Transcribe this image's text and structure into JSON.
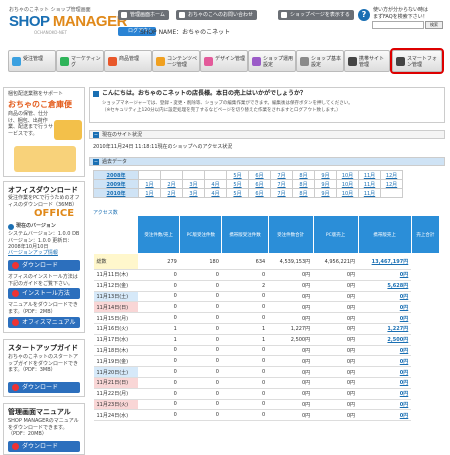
{
  "header": {
    "brand_sub": "おちゃのこネット ショップ管理画面",
    "brand_main_a": "SHOP ",
    "brand_main_b": "MANAGER",
    "brand_tag": "OCHANOKO-NET",
    "btn_home": "管理画面ホーム",
    "btn_contact": "おちゃのこへのお問い合わせ",
    "btn_shop": "ショップページを表示する",
    "logout": "ログアウト",
    "shop_name": "SHOP NAME：おちゃのこネット",
    "help_text": "使い方が分からない時は\nまずFAQを検索下さい！",
    "help_button": "検索"
  },
  "nav": [
    {
      "label": "受注管理",
      "color": "#3aa0e0"
    },
    {
      "label": "マーケティング",
      "color": "#2fb45a"
    },
    {
      "label": "商品管理",
      "color": "#e8572a"
    },
    {
      "label": "コンテンツページ管理",
      "color": "#f0a020"
    },
    {
      "label": "デザイン管理",
      "color": "#e35a9a"
    },
    {
      "label": "ショップ運用設定",
      "color": "#9b5bc8"
    },
    {
      "label": "ショップ基本設定",
      "color": "#8a8a8a"
    },
    {
      "label": "携帯サイト管理",
      "color": "#444"
    },
    {
      "label": "スマートフォン管理",
      "color": "#444"
    }
  ],
  "sidebar": {
    "ad_sub": "梱包配送業務をサポート",
    "ad_title": "おちゃのこ倉庫便",
    "ad_text": "商品の保管、仕分け、梱包、出荷作業、配送まで行うサービスです。",
    "office_head": "オフィスダウンロード",
    "office_text": "受注作業をPCで行うためのオフィスのダウンロード（36MB）",
    "office_logo": "OFFICE",
    "version_head": "現在のバージョン",
    "version_text": "システムバージョン：1.0.0 DBバージョン：1.0.0 更新日：2008年10月10日",
    "version_link": "バージョンアップ情報",
    "btn_download": "ダウンロード",
    "install_text": "オフィスのインストール方法は下記のガイドをご覧下さい。",
    "btn_install": "インストール方法",
    "manual_text": "マニュアルをダウンロードできます。（PDF：2MB）",
    "btn_office_manual": "オフィスマニュアル",
    "startup_head": "スタートアップガイド",
    "startup_text": "おちゃのこネットのスタートアップガイドをダウンロードできます。（PDF：3MB）",
    "btn_download2": "ダウンロード",
    "admin_head": "管理画面マニュアル",
    "admin_text": "SHOP MANAGERのマニュアルをダウンロードできます。（PDF：20MB）",
    "btn_download3": "ダウンロード"
  },
  "main": {
    "greeting": "こんにちは。おちゃのこネットの店長様。本日の売上はいかがでしょうか？",
    "notice1": "ショップマネージャーでは、登録・変更・削除等、ショップの編集作業ができます。編集後は保存ボタンを押してください。",
    "notice2": "（※セキュリティ上120分以内に設定処理を完了するなどページを切り替えた作業をされますとログアウト致します。）",
    "status_title": "現在のサイト状況",
    "status_time": "2010年11月24日 11:18:11現在のショップへのアクセス状況",
    "past_title": "過去データ",
    "years": [
      {
        "year": "2008年",
        "months": [
          "",
          "",
          "",
          "",
          "5月",
          "6月",
          "7月",
          "8月",
          "9月",
          "10月",
          "11月",
          "12月"
        ]
      },
      {
        "year": "2009年",
        "months": [
          "1月",
          "2月",
          "3月",
          "4月",
          "5月",
          "6月",
          "7月",
          "8月",
          "9月",
          "10月",
          "11月",
          "12月"
        ]
      },
      {
        "year": "2010年",
        "months": [
          "1月",
          "2月",
          "3月",
          "4月",
          "5月",
          "6月",
          "7月",
          "8月",
          "9月",
          "10月",
          "11月",
          ""
        ]
      }
    ],
    "access_link": "アクセス数",
    "headers": [
      "受注件数/売上",
      "PC版受注件数",
      "携帯版受注件数",
      "受注件数合計",
      "PC版売上",
      "携帯版売上",
      "売上合計"
    ],
    "total_row": {
      "label": "総数",
      "pc": "279",
      "mobile": "180",
      "total": "634",
      "pc_sales": "4,539,153円",
      "mobile_sales": "4,956,221円",
      "sum": "13,467,197円"
    },
    "rows": [
      {
        "day": "11月11日(木)",
        "type": "",
        "a": "0",
        "b": "0",
        "c": "0",
        "d": "0円",
        "e": "0円",
        "f": "0円"
      },
      {
        "day": "11月12日(金)",
        "type": "",
        "a": "0",
        "b": "0",
        "c": "2",
        "d": "0円",
        "e": "0円",
        "f": "5,628円"
      },
      {
        "day": "11月13日(土)",
        "type": "sat",
        "a": "0",
        "b": "0",
        "c": "0",
        "d": "0円",
        "e": "0円",
        "f": "0円"
      },
      {
        "day": "11月14日(日)",
        "type": "sun",
        "a": "0",
        "b": "0",
        "c": "0",
        "d": "0円",
        "e": "0円",
        "f": "0円"
      },
      {
        "day": "11月15日(月)",
        "type": "",
        "a": "0",
        "b": "0",
        "c": "0",
        "d": "0円",
        "e": "0円",
        "f": "0円"
      },
      {
        "day": "11月16日(火)",
        "type": "",
        "a": "1",
        "b": "0",
        "c": "1",
        "d": "1,227円",
        "e": "0円",
        "f": "1,227円"
      },
      {
        "day": "11月17日(水)",
        "type": "",
        "a": "1",
        "b": "0",
        "c": "1",
        "d": "2,500円",
        "e": "0円",
        "f": "2,500円"
      },
      {
        "day": "11月18日(木)",
        "type": "",
        "a": "0",
        "b": "0",
        "c": "0",
        "d": "0円",
        "e": "0円",
        "f": "0円"
      },
      {
        "day": "11月19日(金)",
        "type": "",
        "a": "0",
        "b": "0",
        "c": "0",
        "d": "0円",
        "e": "0円",
        "f": "0円"
      },
      {
        "day": "11月20日(土)",
        "type": "sat",
        "a": "0",
        "b": "0",
        "c": "0",
        "d": "0円",
        "e": "0円",
        "f": "0円"
      },
      {
        "day": "11月21日(日)",
        "type": "sun",
        "a": "0",
        "b": "0",
        "c": "0",
        "d": "0円",
        "e": "0円",
        "f": "0円"
      },
      {
        "day": "11月22日(月)",
        "type": "",
        "a": "0",
        "b": "0",
        "c": "0",
        "d": "0円",
        "e": "0円",
        "f": "0円"
      },
      {
        "day": "11月23日(火)",
        "type": "sun",
        "a": "0",
        "b": "0",
        "c": "0",
        "d": "0円",
        "e": "0円",
        "f": "0円"
      },
      {
        "day": "11月24日(水)",
        "type": "",
        "a": "0",
        "b": "0",
        "c": "0",
        "d": "0円",
        "e": "0円",
        "f": "0円"
      }
    ]
  }
}
